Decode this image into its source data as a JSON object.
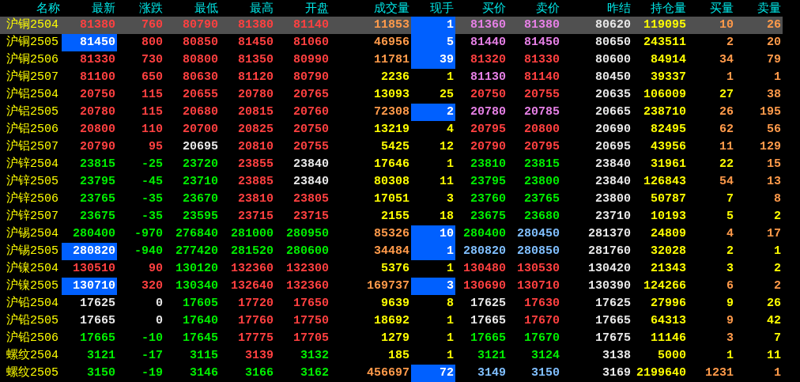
{
  "table": {
    "columns": [
      "名称",
      "最新",
      "涨跌",
      "最低",
      "最高",
      "开盘",
      "成交量",
      "现手",
      "买价",
      "卖价",
      "昨结",
      "持仓量",
      "买量",
      "卖量"
    ],
    "rows": [
      {
        "selected": true,
        "cells": [
          {
            "text": "沪铜2504",
            "color": "#ffff00",
            "highlighted": false
          },
          {
            "text": "81380",
            "color": "#ff4040",
            "highlighted": false
          },
          {
            "text": "760",
            "color": "#ff4040",
            "highlighted": false
          },
          {
            "text": "80790",
            "color": "#ff4040",
            "highlighted": false
          },
          {
            "text": "81380",
            "color": "#ff4040",
            "highlighted": false
          },
          {
            "text": "81140",
            "color": "#ff4040",
            "highlighted": false
          },
          {
            "text": "11853",
            "color": "#ff9a4a",
            "highlighted": false
          },
          {
            "text": "1",
            "color": "#ffffff",
            "highlighted": true
          },
          {
            "text": "81360",
            "color": "#e680e6",
            "highlighted": false
          },
          {
            "text": "81380",
            "color": "#e680e6",
            "highlighted": false
          },
          {
            "text": "80620",
            "color": "#e8e8e8",
            "highlighted": false
          },
          {
            "text": "119095",
            "color": "#ffff00",
            "highlighted": false
          },
          {
            "text": "10",
            "color": "#ff9a4a",
            "highlighted": false
          },
          {
            "text": "26",
            "color": "#ff9a4a",
            "highlighted": false
          }
        ]
      },
      {
        "selected": false,
        "cells": [
          {
            "text": "沪铜2505",
            "color": "#ffff00",
            "highlighted": false
          },
          {
            "text": "81450",
            "color": "#ffffff",
            "highlighted": true
          },
          {
            "text": "800",
            "color": "#ff4040",
            "highlighted": false
          },
          {
            "text": "80850",
            "color": "#ff4040",
            "highlighted": false
          },
          {
            "text": "81450",
            "color": "#ff4040",
            "highlighted": false
          },
          {
            "text": "81060",
            "color": "#ff4040",
            "highlighted": false
          },
          {
            "text": "46956",
            "color": "#ff9a4a",
            "highlighted": false
          },
          {
            "text": "5",
            "color": "#ffffff",
            "highlighted": true
          },
          {
            "text": "81440",
            "color": "#e680e6",
            "highlighted": false
          },
          {
            "text": "81450",
            "color": "#e680e6",
            "highlighted": false
          },
          {
            "text": "80650",
            "color": "#e8e8e8",
            "highlighted": false
          },
          {
            "text": "243511",
            "color": "#ffff00",
            "highlighted": false
          },
          {
            "text": "2",
            "color": "#ff9a4a",
            "highlighted": false
          },
          {
            "text": "20",
            "color": "#ff9a4a",
            "highlighted": false
          }
        ]
      },
      {
        "selected": false,
        "cells": [
          {
            "text": "沪铜2506",
            "color": "#ffff00",
            "highlighted": false
          },
          {
            "text": "81330",
            "color": "#ff4040",
            "highlighted": false
          },
          {
            "text": "730",
            "color": "#ff4040",
            "highlighted": false
          },
          {
            "text": "80800",
            "color": "#ff4040",
            "highlighted": false
          },
          {
            "text": "81350",
            "color": "#ff4040",
            "highlighted": false
          },
          {
            "text": "80990",
            "color": "#ff4040",
            "highlighted": false
          },
          {
            "text": "11781",
            "color": "#ff9a4a",
            "highlighted": false
          },
          {
            "text": "39",
            "color": "#ffffff",
            "highlighted": true
          },
          {
            "text": "81320",
            "color": "#ff4040",
            "highlighted": false
          },
          {
            "text": "81330",
            "color": "#ff4040",
            "highlighted": false
          },
          {
            "text": "80600",
            "color": "#e8e8e8",
            "highlighted": false
          },
          {
            "text": "84914",
            "color": "#ffff00",
            "highlighted": false
          },
          {
            "text": "34",
            "color": "#ff9a4a",
            "highlighted": false
          },
          {
            "text": "79",
            "color": "#ff9a4a",
            "highlighted": false
          }
        ]
      },
      {
        "selected": false,
        "cells": [
          {
            "text": "沪铜2507",
            "color": "#ffff00",
            "highlighted": false
          },
          {
            "text": "81100",
            "color": "#ff4040",
            "highlighted": false
          },
          {
            "text": "650",
            "color": "#ff4040",
            "highlighted": false
          },
          {
            "text": "80630",
            "color": "#ff4040",
            "highlighted": false
          },
          {
            "text": "81120",
            "color": "#ff4040",
            "highlighted": false
          },
          {
            "text": "80790",
            "color": "#ff4040",
            "highlighted": false
          },
          {
            "text": "2236",
            "color": "#ffff00",
            "highlighted": false
          },
          {
            "text": "1",
            "color": "#ffff00",
            "highlighted": false
          },
          {
            "text": "81130",
            "color": "#e680e6",
            "highlighted": false
          },
          {
            "text": "81140",
            "color": "#ff4040",
            "highlighted": false
          },
          {
            "text": "80450",
            "color": "#e8e8e8",
            "highlighted": false
          },
          {
            "text": "39337",
            "color": "#ffff00",
            "highlighted": false
          },
          {
            "text": "1",
            "color": "#ff9a4a",
            "highlighted": false
          },
          {
            "text": "1",
            "color": "#ff9a4a",
            "highlighted": false
          }
        ]
      },
      {
        "selected": false,
        "cells": [
          {
            "text": "沪铝2504",
            "color": "#ffff00",
            "highlighted": false
          },
          {
            "text": "20750",
            "color": "#ff4040",
            "highlighted": false
          },
          {
            "text": "115",
            "color": "#ff4040",
            "highlighted": false
          },
          {
            "text": "20655",
            "color": "#ff4040",
            "highlighted": false
          },
          {
            "text": "20780",
            "color": "#ff4040",
            "highlighted": false
          },
          {
            "text": "20765",
            "color": "#ff4040",
            "highlighted": false
          },
          {
            "text": "13093",
            "color": "#ffff00",
            "highlighted": false
          },
          {
            "text": "25",
            "color": "#ffff00",
            "highlighted": false
          },
          {
            "text": "20750",
            "color": "#ff4040",
            "highlighted": false
          },
          {
            "text": "20755",
            "color": "#ff4040",
            "highlighted": false
          },
          {
            "text": "20635",
            "color": "#e8e8e8",
            "highlighted": false
          },
          {
            "text": "106009",
            "color": "#ffff00",
            "highlighted": false
          },
          {
            "text": "27",
            "color": "#ffff00",
            "highlighted": false
          },
          {
            "text": "38",
            "color": "#ff9a4a",
            "highlighted": false
          }
        ]
      },
      {
        "selected": false,
        "cells": [
          {
            "text": "沪铝2505",
            "color": "#ffff00",
            "highlighted": false
          },
          {
            "text": "20780",
            "color": "#ff4040",
            "highlighted": false
          },
          {
            "text": "115",
            "color": "#ff4040",
            "highlighted": false
          },
          {
            "text": "20680",
            "color": "#ff4040",
            "highlighted": false
          },
          {
            "text": "20815",
            "color": "#ff4040",
            "highlighted": false
          },
          {
            "text": "20760",
            "color": "#ff4040",
            "highlighted": false
          },
          {
            "text": "72308",
            "color": "#ff9a4a",
            "highlighted": false
          },
          {
            "text": "2",
            "color": "#ffffff",
            "highlighted": true
          },
          {
            "text": "20780",
            "color": "#e680e6",
            "highlighted": false
          },
          {
            "text": "20785",
            "color": "#e680e6",
            "highlighted": false
          },
          {
            "text": "20665",
            "color": "#e8e8e8",
            "highlighted": false
          },
          {
            "text": "238710",
            "color": "#ffff00",
            "highlighted": false
          },
          {
            "text": "26",
            "color": "#ff9a4a",
            "highlighted": false
          },
          {
            "text": "195",
            "color": "#ff9a4a",
            "highlighted": false
          }
        ]
      },
      {
        "selected": false,
        "cells": [
          {
            "text": "沪铝2506",
            "color": "#ffff00",
            "highlighted": false
          },
          {
            "text": "20800",
            "color": "#ff4040",
            "highlighted": false
          },
          {
            "text": "110",
            "color": "#ff4040",
            "highlighted": false
          },
          {
            "text": "20700",
            "color": "#ff4040",
            "highlighted": false
          },
          {
            "text": "20825",
            "color": "#ff4040",
            "highlighted": false
          },
          {
            "text": "20750",
            "color": "#ff4040",
            "highlighted": false
          },
          {
            "text": "13219",
            "color": "#ffff00",
            "highlighted": false
          },
          {
            "text": "4",
            "color": "#ffff00",
            "highlighted": false
          },
          {
            "text": "20795",
            "color": "#ff4040",
            "highlighted": false
          },
          {
            "text": "20800",
            "color": "#ff4040",
            "highlighted": false
          },
          {
            "text": "20690",
            "color": "#e8e8e8",
            "highlighted": false
          },
          {
            "text": "82495",
            "color": "#ffff00",
            "highlighted": false
          },
          {
            "text": "62",
            "color": "#ff9a4a",
            "highlighted": false
          },
          {
            "text": "56",
            "color": "#ff9a4a",
            "highlighted": false
          }
        ]
      },
      {
        "selected": false,
        "cells": [
          {
            "text": "沪铝2507",
            "color": "#ffff00",
            "highlighted": false
          },
          {
            "text": "20790",
            "color": "#ff4040",
            "highlighted": false
          },
          {
            "text": "95",
            "color": "#ff4040",
            "highlighted": false
          },
          {
            "text": "20695",
            "color": "#e8e8e8",
            "highlighted": false
          },
          {
            "text": "20810",
            "color": "#ff4040",
            "highlighted": false
          },
          {
            "text": "20755",
            "color": "#ff4040",
            "highlighted": false
          },
          {
            "text": "5425",
            "color": "#ffff00",
            "highlighted": false
          },
          {
            "text": "12",
            "color": "#ffff00",
            "highlighted": false
          },
          {
            "text": "20790",
            "color": "#ff4040",
            "highlighted": false
          },
          {
            "text": "20795",
            "color": "#ff4040",
            "highlighted": false
          },
          {
            "text": "20695",
            "color": "#e8e8e8",
            "highlighted": false
          },
          {
            "text": "43956",
            "color": "#ffff00",
            "highlighted": false
          },
          {
            "text": "11",
            "color": "#ff9a4a",
            "highlighted": false
          },
          {
            "text": "129",
            "color": "#ff9a4a",
            "highlighted": false
          }
        ]
      },
      {
        "selected": false,
        "cells": [
          {
            "text": "沪锌2504",
            "color": "#ffff00",
            "highlighted": false
          },
          {
            "text": "23815",
            "color": "#00ee00",
            "highlighted": false
          },
          {
            "text": "-25",
            "color": "#00ee00",
            "highlighted": false
          },
          {
            "text": "23720",
            "color": "#00ee00",
            "highlighted": false
          },
          {
            "text": "23855",
            "color": "#ff4040",
            "highlighted": false
          },
          {
            "text": "23840",
            "color": "#e8e8e8",
            "highlighted": false
          },
          {
            "text": "17646",
            "color": "#ffff00",
            "highlighted": false
          },
          {
            "text": "1",
            "color": "#ffff00",
            "highlighted": false
          },
          {
            "text": "23810",
            "color": "#00ee00",
            "highlighted": false
          },
          {
            "text": "23815",
            "color": "#00ee00",
            "highlighted": false
          },
          {
            "text": "23840",
            "color": "#e8e8e8",
            "highlighted": false
          },
          {
            "text": "31961",
            "color": "#ffff00",
            "highlighted": false
          },
          {
            "text": "22",
            "color": "#ffff00",
            "highlighted": false
          },
          {
            "text": "15",
            "color": "#ff9a4a",
            "highlighted": false
          }
        ]
      },
      {
        "selected": false,
        "cells": [
          {
            "text": "沪锌2505",
            "color": "#ffff00",
            "highlighted": false
          },
          {
            "text": "23795",
            "color": "#00ee00",
            "highlighted": false
          },
          {
            "text": "-45",
            "color": "#00ee00",
            "highlighted": false
          },
          {
            "text": "23710",
            "color": "#00ee00",
            "highlighted": false
          },
          {
            "text": "23885",
            "color": "#ff4040",
            "highlighted": false
          },
          {
            "text": "23840",
            "color": "#e8e8e8",
            "highlighted": false
          },
          {
            "text": "80308",
            "color": "#ffff00",
            "highlighted": false
          },
          {
            "text": "11",
            "color": "#ffff00",
            "highlighted": false
          },
          {
            "text": "23795",
            "color": "#00ee00",
            "highlighted": false
          },
          {
            "text": "23800",
            "color": "#00ee00",
            "highlighted": false
          },
          {
            "text": "23840",
            "color": "#e8e8e8",
            "highlighted": false
          },
          {
            "text": "126843",
            "color": "#ffff00",
            "highlighted": false
          },
          {
            "text": "54",
            "color": "#ff9a4a",
            "highlighted": false
          },
          {
            "text": "13",
            "color": "#ff9a4a",
            "highlighted": false
          }
        ]
      },
      {
        "selected": false,
        "cells": [
          {
            "text": "沪锌2506",
            "color": "#ffff00",
            "highlighted": false
          },
          {
            "text": "23765",
            "color": "#00ee00",
            "highlighted": false
          },
          {
            "text": "-35",
            "color": "#00ee00",
            "highlighted": false
          },
          {
            "text": "23670",
            "color": "#00ee00",
            "highlighted": false
          },
          {
            "text": "23810",
            "color": "#ff4040",
            "highlighted": false
          },
          {
            "text": "23805",
            "color": "#ff4040",
            "highlighted": false
          },
          {
            "text": "17051",
            "color": "#ffff00",
            "highlighted": false
          },
          {
            "text": "3",
            "color": "#ffff00",
            "highlighted": false
          },
          {
            "text": "23760",
            "color": "#00ee00",
            "highlighted": false
          },
          {
            "text": "23765",
            "color": "#00ee00",
            "highlighted": false
          },
          {
            "text": "23800",
            "color": "#e8e8e8",
            "highlighted": false
          },
          {
            "text": "50787",
            "color": "#ffff00",
            "highlighted": false
          },
          {
            "text": "7",
            "color": "#ffff00",
            "highlighted": false
          },
          {
            "text": "8",
            "color": "#ff9a4a",
            "highlighted": false
          }
        ]
      },
      {
        "selected": false,
        "cells": [
          {
            "text": "沪锌2507",
            "color": "#ffff00",
            "highlighted": false
          },
          {
            "text": "23675",
            "color": "#00ee00",
            "highlighted": false
          },
          {
            "text": "-35",
            "color": "#00ee00",
            "highlighted": false
          },
          {
            "text": "23595",
            "color": "#00ee00",
            "highlighted": false
          },
          {
            "text": "23715",
            "color": "#ff4040",
            "highlighted": false
          },
          {
            "text": "23715",
            "color": "#ff4040",
            "highlighted": false
          },
          {
            "text": "2155",
            "color": "#ffff00",
            "highlighted": false
          },
          {
            "text": "18",
            "color": "#ffff00",
            "highlighted": false
          },
          {
            "text": "23675",
            "color": "#00ee00",
            "highlighted": false
          },
          {
            "text": "23680",
            "color": "#00ee00",
            "highlighted": false
          },
          {
            "text": "23710",
            "color": "#e8e8e8",
            "highlighted": false
          },
          {
            "text": "10193",
            "color": "#ffff00",
            "highlighted": false
          },
          {
            "text": "5",
            "color": "#ffff00",
            "highlighted": false
          },
          {
            "text": "2",
            "color": "#ffff00",
            "highlighted": false
          }
        ]
      },
      {
        "selected": false,
        "cells": [
          {
            "text": "沪锡2504",
            "color": "#ffff00",
            "highlighted": false
          },
          {
            "text": "280400",
            "color": "#00ee00",
            "highlighted": false
          },
          {
            "text": "-970",
            "color": "#00ee00",
            "highlighted": false
          },
          {
            "text": "276840",
            "color": "#00ee00",
            "highlighted": false
          },
          {
            "text": "281000",
            "color": "#00ee00",
            "highlighted": false
          },
          {
            "text": "280950",
            "color": "#00ee00",
            "highlighted": false
          },
          {
            "text": "85326",
            "color": "#ff9a4a",
            "highlighted": false
          },
          {
            "text": "10",
            "color": "#ffffff",
            "highlighted": true
          },
          {
            "text": "280400",
            "color": "#00ee00",
            "highlighted": false
          },
          {
            "text": "280450",
            "color": "#80bfff",
            "highlighted": false
          },
          {
            "text": "281370",
            "color": "#e8e8e8",
            "highlighted": false
          },
          {
            "text": "24809",
            "color": "#ffff00",
            "highlighted": false
          },
          {
            "text": "4",
            "color": "#ff9a4a",
            "highlighted": false
          },
          {
            "text": "17",
            "color": "#ff9a4a",
            "highlighted": false
          }
        ]
      },
      {
        "selected": false,
        "cells": [
          {
            "text": "沪锡2505",
            "color": "#ffff00",
            "highlighted": false
          },
          {
            "text": "280820",
            "color": "#ffffff",
            "highlighted": true
          },
          {
            "text": "-940",
            "color": "#00ee00",
            "highlighted": false
          },
          {
            "text": "277420",
            "color": "#00ee00",
            "highlighted": false
          },
          {
            "text": "281520",
            "color": "#00ee00",
            "highlighted": false
          },
          {
            "text": "280600",
            "color": "#00ee00",
            "highlighted": false
          },
          {
            "text": "34484",
            "color": "#ff9a4a",
            "highlighted": false
          },
          {
            "text": "1",
            "color": "#ffffff",
            "highlighted": true
          },
          {
            "text": "280820",
            "color": "#80bfff",
            "highlighted": false
          },
          {
            "text": "280850",
            "color": "#80bfff",
            "highlighted": false
          },
          {
            "text": "281760",
            "color": "#e8e8e8",
            "highlighted": false
          },
          {
            "text": "32028",
            "color": "#ffff00",
            "highlighted": false
          },
          {
            "text": "2",
            "color": "#ffff00",
            "highlighted": false
          },
          {
            "text": "1",
            "color": "#ffff00",
            "highlighted": false
          }
        ]
      },
      {
        "selected": false,
        "cells": [
          {
            "text": "沪镍2504",
            "color": "#ffff00",
            "highlighted": false
          },
          {
            "text": "130510",
            "color": "#ff4040",
            "highlighted": false
          },
          {
            "text": "90",
            "color": "#ff4040",
            "highlighted": false
          },
          {
            "text": "130120",
            "color": "#00ee00",
            "highlighted": false
          },
          {
            "text": "132360",
            "color": "#ff4040",
            "highlighted": false
          },
          {
            "text": "132300",
            "color": "#ff4040",
            "highlighted": false
          },
          {
            "text": "5376",
            "color": "#ffff00",
            "highlighted": false
          },
          {
            "text": "1",
            "color": "#ffff00",
            "highlighted": false
          },
          {
            "text": "130480",
            "color": "#ff4040",
            "highlighted": false
          },
          {
            "text": "130530",
            "color": "#ff4040",
            "highlighted": false
          },
          {
            "text": "130420",
            "color": "#e8e8e8",
            "highlighted": false
          },
          {
            "text": "21343",
            "color": "#ffff00",
            "highlighted": false
          },
          {
            "text": "3",
            "color": "#ffff00",
            "highlighted": false
          },
          {
            "text": "2",
            "color": "#ffff00",
            "highlighted": false
          }
        ]
      },
      {
        "selected": false,
        "cells": [
          {
            "text": "沪镍2505",
            "color": "#ffff00",
            "highlighted": false
          },
          {
            "text": "130710",
            "color": "#ffffff",
            "highlighted": true
          },
          {
            "text": "320",
            "color": "#ff4040",
            "highlighted": false
          },
          {
            "text": "130340",
            "color": "#00ee00",
            "highlighted": false
          },
          {
            "text": "132640",
            "color": "#ff4040",
            "highlighted": false
          },
          {
            "text": "132360",
            "color": "#ff4040",
            "highlighted": false
          },
          {
            "text": "169737",
            "color": "#ff9a4a",
            "highlighted": false
          },
          {
            "text": "3",
            "color": "#ffffff",
            "highlighted": true
          },
          {
            "text": "130690",
            "color": "#ff4040",
            "highlighted": false
          },
          {
            "text": "130710",
            "color": "#ff4040",
            "highlighted": false
          },
          {
            "text": "130390",
            "color": "#e8e8e8",
            "highlighted": false
          },
          {
            "text": "124266",
            "color": "#ffff00",
            "highlighted": false
          },
          {
            "text": "6",
            "color": "#ff9a4a",
            "highlighted": false
          },
          {
            "text": "2",
            "color": "#ff9a4a",
            "highlighted": false
          }
        ]
      },
      {
        "selected": false,
        "cells": [
          {
            "text": "沪铅2504",
            "color": "#ffff00",
            "highlighted": false
          },
          {
            "text": "17625",
            "color": "#e8e8e8",
            "highlighted": false
          },
          {
            "text": "0",
            "color": "#e8e8e8",
            "highlighted": false
          },
          {
            "text": "17605",
            "color": "#00ee00",
            "highlighted": false
          },
          {
            "text": "17720",
            "color": "#ff4040",
            "highlighted": false
          },
          {
            "text": "17650",
            "color": "#ff4040",
            "highlighted": false
          },
          {
            "text": "9639",
            "color": "#ffff00",
            "highlighted": false
          },
          {
            "text": "8",
            "color": "#ffff00",
            "highlighted": false
          },
          {
            "text": "17625",
            "color": "#e8e8e8",
            "highlighted": false
          },
          {
            "text": "17630",
            "color": "#ff4040",
            "highlighted": false
          },
          {
            "text": "17625",
            "color": "#e8e8e8",
            "highlighted": false
          },
          {
            "text": "27996",
            "color": "#ffff00",
            "highlighted": false
          },
          {
            "text": "9",
            "color": "#ffff00",
            "highlighted": false
          },
          {
            "text": "26",
            "color": "#ffff00",
            "highlighted": false
          }
        ]
      },
      {
        "selected": false,
        "cells": [
          {
            "text": "沪铅2505",
            "color": "#ffff00",
            "highlighted": false
          },
          {
            "text": "17665",
            "color": "#e8e8e8",
            "highlighted": false
          },
          {
            "text": "0",
            "color": "#e8e8e8",
            "highlighted": false
          },
          {
            "text": "17640",
            "color": "#00ee00",
            "highlighted": false
          },
          {
            "text": "17760",
            "color": "#ff4040",
            "highlighted": false
          },
          {
            "text": "17750",
            "color": "#ff4040",
            "highlighted": false
          },
          {
            "text": "18692",
            "color": "#ffff00",
            "highlighted": false
          },
          {
            "text": "1",
            "color": "#ffff00",
            "highlighted": false
          },
          {
            "text": "17665",
            "color": "#e8e8e8",
            "highlighted": false
          },
          {
            "text": "17670",
            "color": "#ff4040",
            "highlighted": false
          },
          {
            "text": "17665",
            "color": "#e8e8e8",
            "highlighted": false
          },
          {
            "text": "64313",
            "color": "#ffff00",
            "highlighted": false
          },
          {
            "text": "9",
            "color": "#ff9a4a",
            "highlighted": false
          },
          {
            "text": "42",
            "color": "#ffff00",
            "highlighted": false
          }
        ]
      },
      {
        "selected": false,
        "cells": [
          {
            "text": "沪铅2506",
            "color": "#ffff00",
            "highlighted": false
          },
          {
            "text": "17665",
            "color": "#00ee00",
            "highlighted": false
          },
          {
            "text": "-10",
            "color": "#00ee00",
            "highlighted": false
          },
          {
            "text": "17645",
            "color": "#00ee00",
            "highlighted": false
          },
          {
            "text": "17775",
            "color": "#ff4040",
            "highlighted": false
          },
          {
            "text": "17705",
            "color": "#ff4040",
            "highlighted": false
          },
          {
            "text": "1279",
            "color": "#ffff00",
            "highlighted": false
          },
          {
            "text": "1",
            "color": "#ffff00",
            "highlighted": false
          },
          {
            "text": "17665",
            "color": "#00ee00",
            "highlighted": false
          },
          {
            "text": "17670",
            "color": "#00ee00",
            "highlighted": false
          },
          {
            "text": "17675",
            "color": "#e8e8e8",
            "highlighted": false
          },
          {
            "text": "11146",
            "color": "#ffff00",
            "highlighted": false
          },
          {
            "text": "3",
            "color": "#ff9a4a",
            "highlighted": false
          },
          {
            "text": "7",
            "color": "#ffff00",
            "highlighted": false
          }
        ]
      },
      {
        "selected": false,
        "cells": [
          {
            "text": "螺纹2504",
            "color": "#ffff00",
            "highlighted": false
          },
          {
            "text": "3121",
            "color": "#00ee00",
            "highlighted": false
          },
          {
            "text": "-17",
            "color": "#00ee00",
            "highlighted": false
          },
          {
            "text": "3115",
            "color": "#00ee00",
            "highlighted": false
          },
          {
            "text": "3139",
            "color": "#ff4040",
            "highlighted": false
          },
          {
            "text": "3132",
            "color": "#00ee00",
            "highlighted": false
          },
          {
            "text": "185",
            "color": "#ffff00",
            "highlighted": false
          },
          {
            "text": "1",
            "color": "#ffff00",
            "highlighted": false
          },
          {
            "text": "3121",
            "color": "#00ee00",
            "highlighted": false
          },
          {
            "text": "3124",
            "color": "#00ee00",
            "highlighted": false
          },
          {
            "text": "3138",
            "color": "#e8e8e8",
            "highlighted": false
          },
          {
            "text": "5000",
            "color": "#ffff00",
            "highlighted": false
          },
          {
            "text": "1",
            "color": "#ffff00",
            "highlighted": false
          },
          {
            "text": "11",
            "color": "#ffff00",
            "highlighted": false
          }
        ]
      },
      {
        "selected": false,
        "cells": [
          {
            "text": "螺纹2505",
            "color": "#ffff00",
            "highlighted": false
          },
          {
            "text": "3150",
            "color": "#00ee00",
            "highlighted": false
          },
          {
            "text": "-19",
            "color": "#00ee00",
            "highlighted": false
          },
          {
            "text": "3146",
            "color": "#00ee00",
            "highlighted": false
          },
          {
            "text": "3166",
            "color": "#00ee00",
            "highlighted": false
          },
          {
            "text": "3162",
            "color": "#00ee00",
            "highlighted": false
          },
          {
            "text": "456697",
            "color": "#ff9a4a",
            "highlighted": false
          },
          {
            "text": "72",
            "color": "#ffffff",
            "highlighted": true
          },
          {
            "text": "3149",
            "color": "#80bfff",
            "highlighted": false
          },
          {
            "text": "3150",
            "color": "#80bfff",
            "highlighted": false
          },
          {
            "text": "3169",
            "color": "#e8e8e8",
            "highlighted": false
          },
          {
            "text": "2199640",
            "color": "#ffff00",
            "highlighted": false
          },
          {
            "text": "1231",
            "color": "#ff9a4a",
            "highlighted": false
          },
          {
            "text": "1",
            "color": "#ff9a4a",
            "highlighted": false
          }
        ]
      }
    ]
  }
}
